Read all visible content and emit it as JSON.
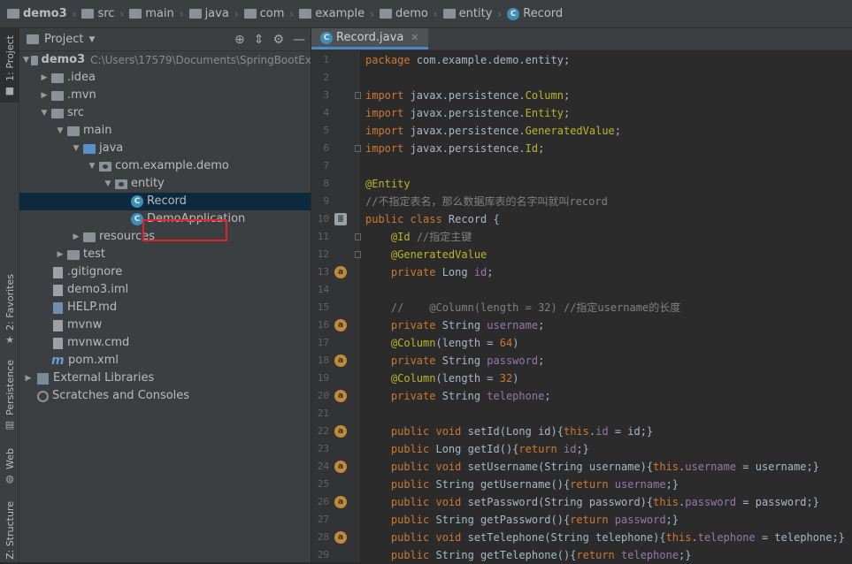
{
  "breadcrumb": [
    "demo3",
    "src",
    "main",
    "java",
    "com",
    "example",
    "demo",
    "entity",
    "Record"
  ],
  "toolwindows": {
    "project_tab": "1: Project",
    "favorites_tab": "2: Favorites",
    "persistence_tab": "Persistence",
    "web_tab": "Web",
    "structure_tab": "Z: Structure"
  },
  "project_panel": {
    "title": "Project",
    "tree": [
      {
        "label": "demo3",
        "extra": "C:\\Users\\17579\\Documents\\SpringBootEx",
        "depth": 0,
        "arrow": "down",
        "icon": "folder",
        "bold": true
      },
      {
        "label": ".idea",
        "depth": 1,
        "arrow": "right",
        "icon": "folder"
      },
      {
        "label": ".mvn",
        "depth": 1,
        "arrow": "right",
        "icon": "folder"
      },
      {
        "label": "src",
        "depth": 1,
        "arrow": "down",
        "icon": "folder"
      },
      {
        "label": "main",
        "depth": 2,
        "arrow": "down",
        "icon": "folder"
      },
      {
        "label": "java",
        "depth": 3,
        "arrow": "down",
        "icon": "folder-blue"
      },
      {
        "label": "com.example.demo",
        "depth": 4,
        "arrow": "down",
        "icon": "package"
      },
      {
        "label": "entity",
        "depth": 5,
        "arrow": "down",
        "icon": "package"
      },
      {
        "label": "Record",
        "depth": 6,
        "arrow": "none",
        "icon": "class",
        "selected": true
      },
      {
        "label": "DemoApplication",
        "depth": 6,
        "arrow": "none",
        "icon": "class"
      },
      {
        "label": "resources",
        "depth": 3,
        "arrow": "right",
        "icon": "folder"
      },
      {
        "label": "test",
        "depth": 2,
        "arrow": "right",
        "icon": "folder"
      },
      {
        "label": ".gitignore",
        "depth": 1,
        "arrow": "none",
        "icon": "file"
      },
      {
        "label": "demo3.iml",
        "depth": 1,
        "arrow": "none",
        "icon": "file"
      },
      {
        "label": "HELP.md",
        "depth": 1,
        "arrow": "none",
        "icon": "md"
      },
      {
        "label": "mvnw",
        "depth": 1,
        "arrow": "none",
        "icon": "file"
      },
      {
        "label": "mvnw.cmd",
        "depth": 1,
        "arrow": "none",
        "icon": "file"
      },
      {
        "label": "pom.xml",
        "depth": 1,
        "arrow": "none",
        "icon": "maven"
      },
      {
        "label": "External Libraries",
        "depth": 0,
        "arrow": "right",
        "icon": "lib"
      },
      {
        "label": "Scratches and Consoles",
        "depth": 0,
        "arrow": "none",
        "icon": "scratch"
      }
    ]
  },
  "editor": {
    "tab_label": "Record.java",
    "lines": [
      {
        "n": "1",
        "t": [
          [
            "kw",
            "package "
          ],
          [
            "",
            "com.example.demo.entity;"
          ]
        ]
      },
      {
        "n": "2",
        "t": []
      },
      {
        "n": "3",
        "t": [
          [
            "kw",
            "import "
          ],
          [
            "",
            "javax.persistence."
          ],
          [
            "ann",
            "Column"
          ],
          [
            "",
            ";"
          ]
        ],
        "fold": true
      },
      {
        "n": "4",
        "t": [
          [
            "kw",
            "import "
          ],
          [
            "",
            "javax.persistence."
          ],
          [
            "ann",
            "Entity"
          ],
          [
            "",
            ";"
          ]
        ]
      },
      {
        "n": "5",
        "t": [
          [
            "kw",
            "import "
          ],
          [
            "",
            "javax.persistence."
          ],
          [
            "ann",
            "GeneratedValue"
          ],
          [
            "",
            ";"
          ]
        ]
      },
      {
        "n": "6",
        "t": [
          [
            "kw",
            "import "
          ],
          [
            "",
            "javax.persistence."
          ],
          [
            "ann",
            "Id"
          ],
          [
            "",
            ";"
          ]
        ],
        "fold": true
      },
      {
        "n": "7",
        "t": []
      },
      {
        "n": "8",
        "t": [
          [
            "ann",
            "@Entity"
          ]
        ]
      },
      {
        "n": "9",
        "t": [
          [
            "cm",
            "//不指定表名，那么数据库表的名字叫就叫record"
          ]
        ]
      },
      {
        "n": "10",
        "t": [
          [
            "kw",
            "public class "
          ],
          [
            "",
            "Record {"
          ]
        ],
        "gutter": "db"
      },
      {
        "n": "11",
        "t": [
          [
            "",
            "    "
          ],
          [
            "ann",
            "@Id "
          ],
          [
            "cm",
            "//指定主键"
          ]
        ],
        "fold": true
      },
      {
        "n": "12",
        "t": [
          [
            "",
            "    "
          ],
          [
            "ann",
            "@GeneratedValue"
          ]
        ],
        "fold": true
      },
      {
        "n": "13",
        "t": [
          [
            "",
            "    "
          ],
          [
            "kw",
            "private "
          ],
          [
            "",
            "Long "
          ],
          [
            "fld",
            "id"
          ],
          [
            "",
            ";"
          ]
        ],
        "gutter": "a"
      },
      {
        "n": "14",
        "t": []
      },
      {
        "n": "15",
        "t": [
          [
            "cm",
            "    //    @Column(length = 32) //指定username的长度"
          ]
        ]
      },
      {
        "n": "16",
        "t": [
          [
            "",
            "    "
          ],
          [
            "kw",
            "private "
          ],
          [
            "",
            "String "
          ],
          [
            "fld",
            "username"
          ],
          [
            "",
            ";"
          ]
        ],
        "gutter": "a"
      },
      {
        "n": "17",
        "t": [
          [
            "",
            "    "
          ],
          [
            "ann",
            "@Column"
          ],
          [
            "",
            "(length = "
          ],
          [
            "kw",
            "64"
          ],
          [
            "",
            ")"
          ]
        ]
      },
      {
        "n": "18",
        "t": [
          [
            "",
            "    "
          ],
          [
            "kw",
            "private "
          ],
          [
            "",
            "String "
          ],
          [
            "fld",
            "password"
          ],
          [
            "",
            ";"
          ]
        ],
        "gutter": "a"
      },
      {
        "n": "19",
        "t": [
          [
            "",
            "    "
          ],
          [
            "ann",
            "@Column"
          ],
          [
            "",
            "(length = "
          ],
          [
            "kw",
            "32"
          ],
          [
            "",
            ")"
          ]
        ]
      },
      {
        "n": "20",
        "t": [
          [
            "",
            "    "
          ],
          [
            "kw",
            "private "
          ],
          [
            "",
            "String "
          ],
          [
            "fld",
            "telephone"
          ],
          [
            "",
            ";"
          ]
        ],
        "gutter": "a"
      },
      {
        "n": "21",
        "t": []
      },
      {
        "n": "22",
        "t": [
          [
            "",
            "    "
          ],
          [
            "kw",
            "public void "
          ],
          [
            "",
            "setId(Long id){"
          ],
          [
            "kw",
            "this"
          ],
          [
            "",
            "."
          ],
          [
            "fld",
            "id"
          ],
          [
            "",
            " = id;}"
          ]
        ],
        "gutter": "a"
      },
      {
        "n": "23",
        "t": [
          [
            "",
            "    "
          ],
          [
            "kw",
            "public "
          ],
          [
            "",
            "Long getId(){"
          ],
          [
            "kw",
            "return "
          ],
          [
            "fld",
            "id"
          ],
          [
            "",
            ";}"
          ]
        ]
      },
      {
        "n": "24",
        "t": [
          [
            "",
            "    "
          ],
          [
            "kw",
            "public void "
          ],
          [
            "",
            "setUsername(String username){"
          ],
          [
            "kw",
            "this"
          ],
          [
            "",
            "."
          ],
          [
            "fld",
            "username"
          ],
          [
            "",
            " = username;}"
          ]
        ],
        "gutter": "a"
      },
      {
        "n": "25",
        "t": [
          [
            "",
            "    "
          ],
          [
            "kw",
            "public "
          ],
          [
            "",
            "String getUsername(){"
          ],
          [
            "kw",
            "return "
          ],
          [
            "fld",
            "username"
          ],
          [
            "",
            ";}"
          ]
        ]
      },
      {
        "n": "26",
        "t": [
          [
            "",
            "    "
          ],
          [
            "kw",
            "public void "
          ],
          [
            "",
            "setPassword(String password){"
          ],
          [
            "kw",
            "this"
          ],
          [
            "",
            "."
          ],
          [
            "fld",
            "password"
          ],
          [
            "",
            " = password;}"
          ]
        ],
        "gutter": "a"
      },
      {
        "n": "27",
        "t": [
          [
            "",
            "    "
          ],
          [
            "kw",
            "public "
          ],
          [
            "",
            "String getPassword(){"
          ],
          [
            "kw",
            "return "
          ],
          [
            "fld",
            "password"
          ],
          [
            "",
            ";}"
          ]
        ]
      },
      {
        "n": "28",
        "t": [
          [
            "",
            "    "
          ],
          [
            "kw",
            "public void "
          ],
          [
            "",
            "setTelephone(String telephone){"
          ],
          [
            "kw",
            "this"
          ],
          [
            "",
            "."
          ],
          [
            "fld",
            "telephone"
          ],
          [
            "",
            " = telephone;}"
          ]
        ],
        "gutter": "a"
      },
      {
        "n": "29",
        "t": [
          [
            "",
            "    "
          ],
          [
            "kw",
            "public "
          ],
          [
            "",
            "String getTelephone(){"
          ],
          [
            "kw",
            "return "
          ],
          [
            "fld",
            "telephone"
          ],
          [
            "",
            ";}"
          ]
        ]
      }
    ]
  },
  "colors": {
    "editor_bg": "#2b2b2b",
    "panel_bg": "#3c3f41",
    "keyword": "#cc7832",
    "annotation": "#bbb529",
    "comment": "#808080",
    "field": "#9876aa",
    "selection": "#0d293e",
    "highlight_box": "#e0262c"
  }
}
